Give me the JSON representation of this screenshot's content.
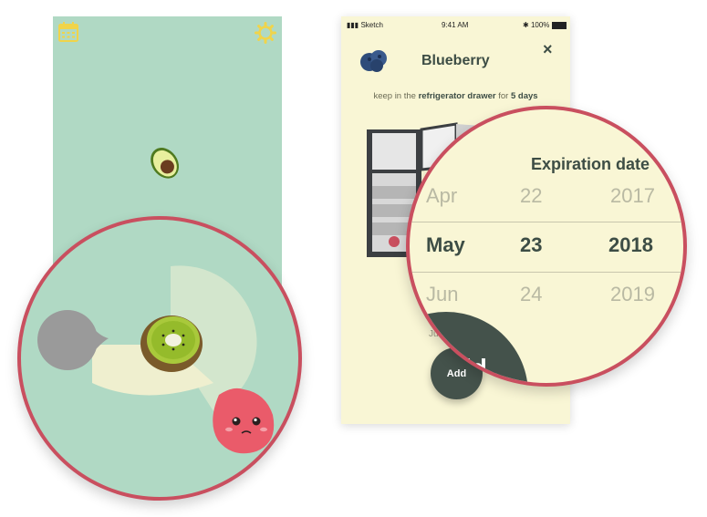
{
  "left": {
    "top_icons": [
      "calendar-icon",
      "gear-icon"
    ],
    "colors": {
      "background": "#b0d9c4",
      "accent": "#f0d44a",
      "strawberry": "#ea5b6a"
    }
  },
  "phone": {
    "status": {
      "carrier": "Sketch",
      "time": "9:41 AM",
      "battery": "100%"
    },
    "title": "Blueberry",
    "close": "×",
    "hint": {
      "prefix": "keep in the",
      "place": "refrigerator drawer",
      "mid": "for",
      "duration": "5 days"
    },
    "add_label": "Add",
    "under_text": "Ju"
  },
  "picker": {
    "title": "Expiration date",
    "rows": [
      {
        "month": "Apr",
        "day": "22",
        "year": "2017"
      },
      {
        "month": "May",
        "day": "23",
        "year": "2018"
      },
      {
        "month": "Jun",
        "day": "24",
        "year": "2019"
      }
    ],
    "add_fragment": "ld"
  }
}
